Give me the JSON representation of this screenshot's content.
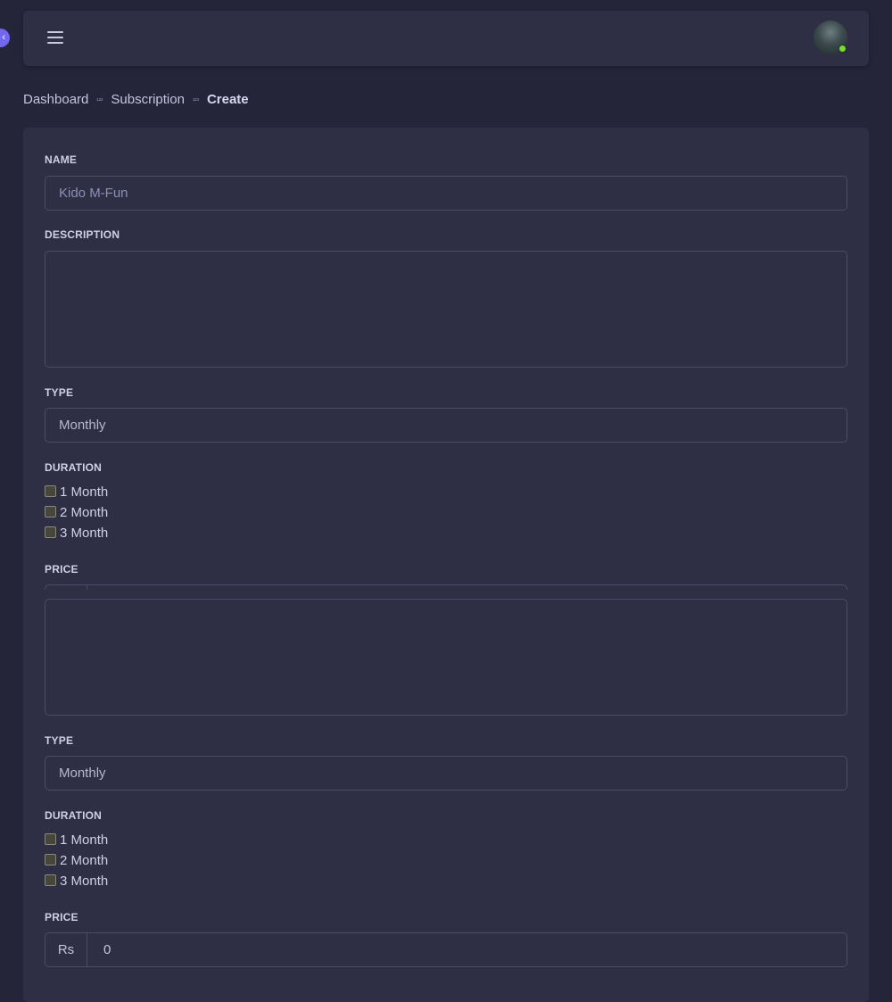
{
  "header": {
    "menu_icon": "hamburger-icon",
    "avatar_icon": "user-avatar",
    "status_color": "#72e128",
    "sidebar_toggle_icon": "chevron-left-icon",
    "sidebar_toggle_glyph": "‹"
  },
  "breadcrumb": {
    "items": [
      "Dashboard",
      "Subscription",
      "Create"
    ],
    "separator": "¹²³"
  },
  "form": {
    "name_label": "NAME",
    "name_value": "Kido M-Fun",
    "description_label": "DESCRIPTION",
    "type_label": "TYPE",
    "type_value": "Monthly",
    "duration_label": "DURATION",
    "duration_options": [
      "1 Month",
      "2 Month",
      "3 Month"
    ],
    "price_label": "PRICE",
    "second_block": {
      "type_label": "TYPE",
      "type_value": "Monthly",
      "duration_label": "DURATION",
      "duration_options": [
        "1 Month",
        "2 Month",
        "3 Month"
      ],
      "price_label": "PRICE",
      "price_currency": "Rs",
      "price_value": "0"
    }
  },
  "colors": {
    "accent": "#7367f0",
    "page_bg": "#25253a",
    "card_bg": "#2e2e44",
    "border": "#4a4b66"
  }
}
